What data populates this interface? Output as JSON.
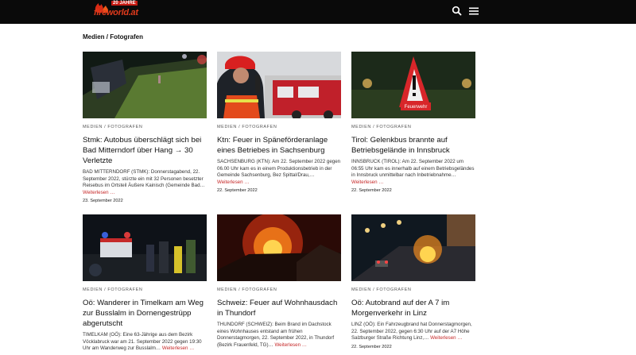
{
  "header": {
    "logo_text": "fireworld.at",
    "logo_badge": "20 JAHRE",
    "search_icon": "search-icon",
    "menu_icon": "hamburger-menu-icon",
    "bg_color": "#0a0a0a",
    "accent_color": "#c62828"
  },
  "page": {
    "title": "Medien / Fotografen"
  },
  "articles": [
    {
      "category": "Medien / Fotografen",
      "title": "Stmk: Autobus überschlägt sich bei Bad Mitterndorf über Hang → 30 Verletzte",
      "excerpt": "BAD MITTERNDORF (STMK): Donnerstagabend, 22. September 2022, stürzte ein mit 32 Personen besetzter Reisebus im Ortsteil Äußere Kainisch (Gemeinde Bad…",
      "more": "Weiterlesen …",
      "date": "23. September 2022"
    },
    {
      "category": "Medien / Fotografen",
      "title": "Ktn: Feuer in Späneförderanlage eines Betriebes in Sachsenburg",
      "excerpt": "SACHSENBURG (KTN): Am 22. September 2022 gegen 06.00 Uhr kam es in einem Produktionsbetrieb in der Gemeinde Sachsenburg, Bez Spittal/Drau,…",
      "more": "Weiterlesen …",
      "date": "22. September 2022"
    },
    {
      "category": "Medien / Fotografen",
      "title": "Tirol: Gelenkbus brannte auf Betriebsgelände in Innsbruck",
      "excerpt": "INNSBRUCK (TIROL): Am 22. September 2022 um 06:55 Uhr kam es innerhalb auf einem Betriebsgeländes in Innsbruck unmittelbar nach Inbetriebnahme…",
      "more": "Weiterlesen …",
      "date": "22. September 2022",
      "sign_text": "Feuerwehr"
    },
    {
      "category": "Medien / Fotografen",
      "title": "Oö: Wanderer in Timelkam am Weg zur Busslalm in Dornengestrüpp abgerutscht",
      "excerpt": "TIMELKAM (OÖ): Eine 63-Jährige aus dem Bezirk Vöcklabruck war am 21. September 2022 gegen 19:30 Uhr am Wanderweg zur Busslalm…",
      "more": "Weiterlesen …",
      "date": ""
    },
    {
      "category": "Medien / Fotografen",
      "title": "Schweiz: Feuer auf Wohnhausdach in Thundorf",
      "excerpt": "THUNDORF (SCHWEIZ): Beim Brand im Dachstock eines Wohnhauses entstand am frühen Donnerstagmorgen, 22. September 2022, in Thundorf (Bezirk Frauenfeld, TG)…",
      "more": "Weiterlesen …",
      "date": ""
    },
    {
      "category": "Medien / Fotografen",
      "title": "Oö: Autobrand auf der A 7 im Morgenverkehr in Linz",
      "excerpt": "LINZ (OÖ): Ein Fahrzeugbrand hat Donnerstagmorgen, 22. September 2022, gegen 6:30 Uhr auf der A7 Höhe Salzburger Straße Richtung Linz,…",
      "more": "Weiterlesen …",
      "date": "22. September 2022"
    }
  ]
}
